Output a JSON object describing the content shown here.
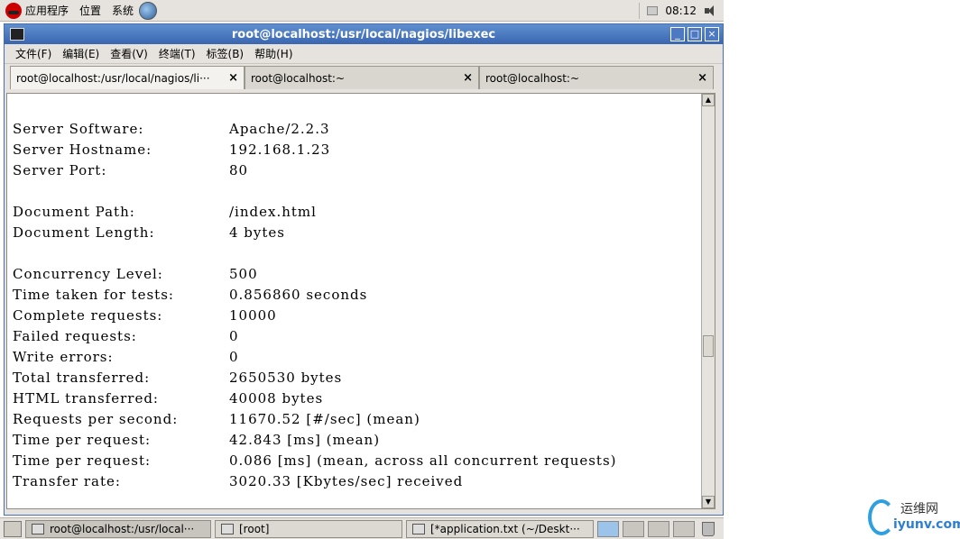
{
  "top_panel": {
    "menu": [
      "应用程序",
      "位置",
      "系统"
    ],
    "clock": "08:12"
  },
  "window": {
    "title": "root@localhost:/usr/local/nagios/libexec",
    "buttons": [
      "_",
      "□",
      "×"
    ]
  },
  "menubar": [
    "文件(F)",
    "编辑(E)",
    "查看(V)",
    "终端(T)",
    "标签(B)",
    "帮助(H)"
  ],
  "tabs": [
    {
      "label": "root@localhost:/usr/local/nagios/li···",
      "close": "×"
    },
    {
      "label": "root@localhost:~",
      "close": "×"
    },
    {
      "label": "root@localhost:~",
      "close": "×"
    }
  ],
  "terminal": {
    "lines": [
      {
        "key": "Server Software:",
        "value": "Apache/2.2.3"
      },
      {
        "key": "Server Hostname:",
        "value": "192.168.1.23"
      },
      {
        "key": "Server Port:",
        "value": "80"
      },
      {
        "key": "",
        "value": ""
      },
      {
        "key": "Document Path:",
        "value": "/index.html"
      },
      {
        "key": "Document Length:",
        "value": "4 bytes"
      },
      {
        "key": "",
        "value": ""
      },
      {
        "key": "Concurrency Level:",
        "value": "500"
      },
      {
        "key": "Time taken for tests:",
        "value": "0.856860 seconds"
      },
      {
        "key": "Complete requests:",
        "value": "10000"
      },
      {
        "key": "Failed requests:",
        "value": "0"
      },
      {
        "key": "Write errors:",
        "value": "0"
      },
      {
        "key": "Total transferred:",
        "value": "2650530 bytes"
      },
      {
        "key": "HTML transferred:",
        "value": "40008 bytes"
      },
      {
        "key": "Requests per second:",
        "value": "11670.52 [#/sec] (mean)"
      },
      {
        "key": "Time per request:",
        "value": "42.843 [ms] (mean)"
      },
      {
        "key": "Time per request:",
        "value": "0.086 [ms] (mean, across all concurrent requests)"
      },
      {
        "key": "Transfer rate:",
        "value": "3020.33 [Kbytes/sec] received"
      }
    ]
  },
  "taskbar": {
    "tasks": [
      {
        "label": "root@localhost:/usr/local···"
      },
      {
        "label": "[root]"
      },
      {
        "label": "[*application.txt (~/Deskt···"
      }
    ]
  },
  "watermark": {
    "cn": "运维网",
    "en": "iyunv.com"
  }
}
